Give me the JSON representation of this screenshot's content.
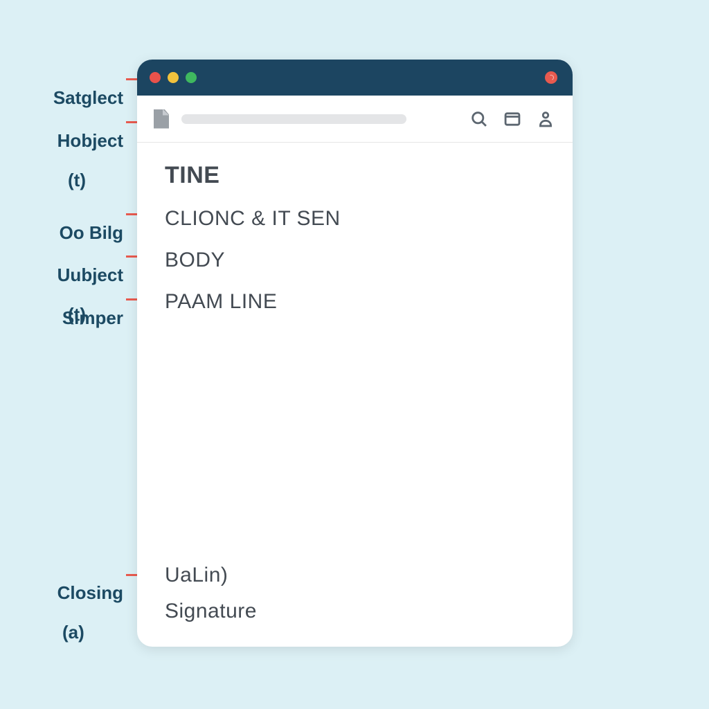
{
  "annotations": {
    "a1": {
      "label": "Satglect"
    },
    "a2": {
      "label": "Hobject",
      "sub": "(t)"
    },
    "a3": {
      "label": "Oo Bilg"
    },
    "a4": {
      "label": "Uubject",
      "sub": "(t)"
    },
    "a5": {
      "label": "Simper"
    },
    "a6": {
      "label": "Closing",
      "sub": "(a)"
    }
  },
  "window": {
    "traffic_colors": {
      "red": "#e9524b",
      "yellow": "#f2c23c",
      "green": "#3fb85f"
    },
    "toolbar": {
      "icons": {
        "doc": "document-icon",
        "search": "search-icon",
        "window": "window-icon",
        "account": "account-icon"
      }
    }
  },
  "document": {
    "heading": "TINE",
    "lines": {
      "l1": "CLIONC & IT SEN",
      "l2": "BODY",
      "l3": "PAAM LINE"
    },
    "closing": "UaLin)",
    "signature": "Signature"
  }
}
